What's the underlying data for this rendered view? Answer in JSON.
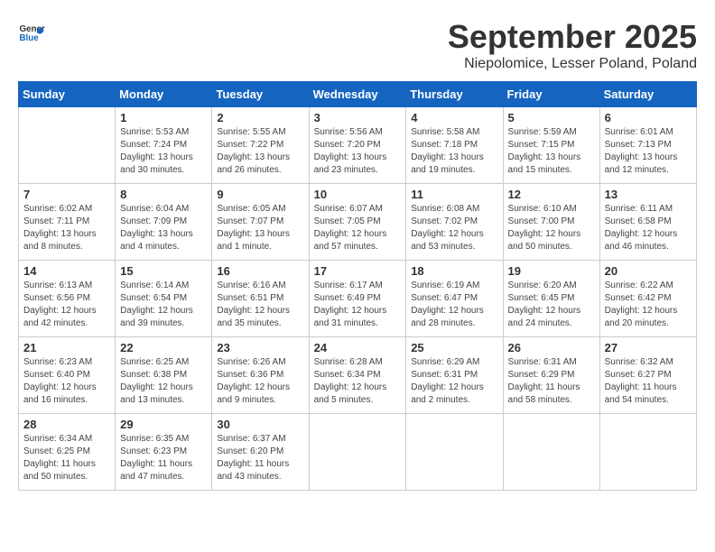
{
  "logo": {
    "text_general": "General",
    "text_blue": "Blue"
  },
  "title": "September 2025",
  "location": "Niepolomice, Lesser Poland, Poland",
  "weekdays": [
    "Sunday",
    "Monday",
    "Tuesday",
    "Wednesday",
    "Thursday",
    "Friday",
    "Saturday"
  ],
  "weeks": [
    [
      {
        "day": "",
        "info": ""
      },
      {
        "day": "1",
        "info": "Sunrise: 5:53 AM\nSunset: 7:24 PM\nDaylight: 13 hours\nand 30 minutes."
      },
      {
        "day": "2",
        "info": "Sunrise: 5:55 AM\nSunset: 7:22 PM\nDaylight: 13 hours\nand 26 minutes."
      },
      {
        "day": "3",
        "info": "Sunrise: 5:56 AM\nSunset: 7:20 PM\nDaylight: 13 hours\nand 23 minutes."
      },
      {
        "day": "4",
        "info": "Sunrise: 5:58 AM\nSunset: 7:18 PM\nDaylight: 13 hours\nand 19 minutes."
      },
      {
        "day": "5",
        "info": "Sunrise: 5:59 AM\nSunset: 7:15 PM\nDaylight: 13 hours\nand 15 minutes."
      },
      {
        "day": "6",
        "info": "Sunrise: 6:01 AM\nSunset: 7:13 PM\nDaylight: 13 hours\nand 12 minutes."
      }
    ],
    [
      {
        "day": "7",
        "info": "Sunrise: 6:02 AM\nSunset: 7:11 PM\nDaylight: 13 hours\nand 8 minutes."
      },
      {
        "day": "8",
        "info": "Sunrise: 6:04 AM\nSunset: 7:09 PM\nDaylight: 13 hours\nand 4 minutes."
      },
      {
        "day": "9",
        "info": "Sunrise: 6:05 AM\nSunset: 7:07 PM\nDaylight: 13 hours\nand 1 minute."
      },
      {
        "day": "10",
        "info": "Sunrise: 6:07 AM\nSunset: 7:05 PM\nDaylight: 12 hours\nand 57 minutes."
      },
      {
        "day": "11",
        "info": "Sunrise: 6:08 AM\nSunset: 7:02 PM\nDaylight: 12 hours\nand 53 minutes."
      },
      {
        "day": "12",
        "info": "Sunrise: 6:10 AM\nSunset: 7:00 PM\nDaylight: 12 hours\nand 50 minutes."
      },
      {
        "day": "13",
        "info": "Sunrise: 6:11 AM\nSunset: 6:58 PM\nDaylight: 12 hours\nand 46 minutes."
      }
    ],
    [
      {
        "day": "14",
        "info": "Sunrise: 6:13 AM\nSunset: 6:56 PM\nDaylight: 12 hours\nand 42 minutes."
      },
      {
        "day": "15",
        "info": "Sunrise: 6:14 AM\nSunset: 6:54 PM\nDaylight: 12 hours\nand 39 minutes."
      },
      {
        "day": "16",
        "info": "Sunrise: 6:16 AM\nSunset: 6:51 PM\nDaylight: 12 hours\nand 35 minutes."
      },
      {
        "day": "17",
        "info": "Sunrise: 6:17 AM\nSunset: 6:49 PM\nDaylight: 12 hours\nand 31 minutes."
      },
      {
        "day": "18",
        "info": "Sunrise: 6:19 AM\nSunset: 6:47 PM\nDaylight: 12 hours\nand 28 minutes."
      },
      {
        "day": "19",
        "info": "Sunrise: 6:20 AM\nSunset: 6:45 PM\nDaylight: 12 hours\nand 24 minutes."
      },
      {
        "day": "20",
        "info": "Sunrise: 6:22 AM\nSunset: 6:42 PM\nDaylight: 12 hours\nand 20 minutes."
      }
    ],
    [
      {
        "day": "21",
        "info": "Sunrise: 6:23 AM\nSunset: 6:40 PM\nDaylight: 12 hours\nand 16 minutes."
      },
      {
        "day": "22",
        "info": "Sunrise: 6:25 AM\nSunset: 6:38 PM\nDaylight: 12 hours\nand 13 minutes."
      },
      {
        "day": "23",
        "info": "Sunrise: 6:26 AM\nSunset: 6:36 PM\nDaylight: 12 hours\nand 9 minutes."
      },
      {
        "day": "24",
        "info": "Sunrise: 6:28 AM\nSunset: 6:34 PM\nDaylight: 12 hours\nand 5 minutes."
      },
      {
        "day": "25",
        "info": "Sunrise: 6:29 AM\nSunset: 6:31 PM\nDaylight: 12 hours\nand 2 minutes."
      },
      {
        "day": "26",
        "info": "Sunrise: 6:31 AM\nSunset: 6:29 PM\nDaylight: 11 hours\nand 58 minutes."
      },
      {
        "day": "27",
        "info": "Sunrise: 6:32 AM\nSunset: 6:27 PM\nDaylight: 11 hours\nand 54 minutes."
      }
    ],
    [
      {
        "day": "28",
        "info": "Sunrise: 6:34 AM\nSunset: 6:25 PM\nDaylight: 11 hours\nand 50 minutes."
      },
      {
        "day": "29",
        "info": "Sunrise: 6:35 AM\nSunset: 6:23 PM\nDaylight: 11 hours\nand 47 minutes."
      },
      {
        "day": "30",
        "info": "Sunrise: 6:37 AM\nSunset: 6:20 PM\nDaylight: 11 hours\nand 43 minutes."
      },
      {
        "day": "",
        "info": ""
      },
      {
        "day": "",
        "info": ""
      },
      {
        "day": "",
        "info": ""
      },
      {
        "day": "",
        "info": ""
      }
    ]
  ]
}
